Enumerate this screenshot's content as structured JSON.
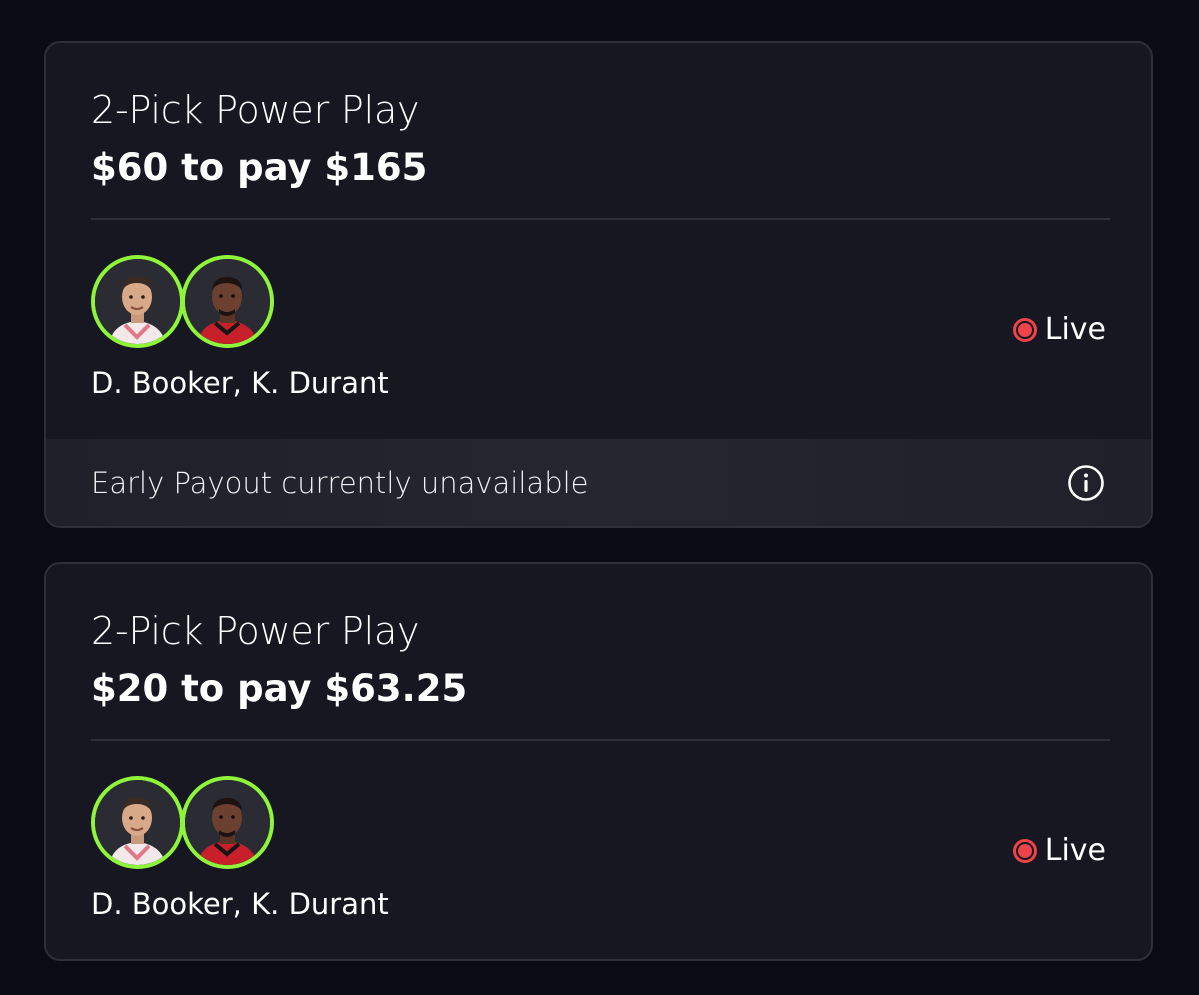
{
  "entries": [
    {
      "title": "2-Pick Power Play",
      "amount": "$60 to pay $165",
      "players": "D. Booker, K. Durant",
      "status": "Live",
      "footer": "Early Payout currently unavailable"
    },
    {
      "title": "2-Pick Power Play",
      "amount": "$20 to pay $63.25",
      "players": "D. Booker, K. Durant",
      "status": "Live"
    }
  ],
  "colors": {
    "background": "#0a0b14",
    "card": "#161720",
    "avatar_ring": "#8ef53a",
    "live": "#f0424a"
  },
  "icons": {
    "live": "record-dot-icon",
    "info": "info-circle-icon"
  }
}
